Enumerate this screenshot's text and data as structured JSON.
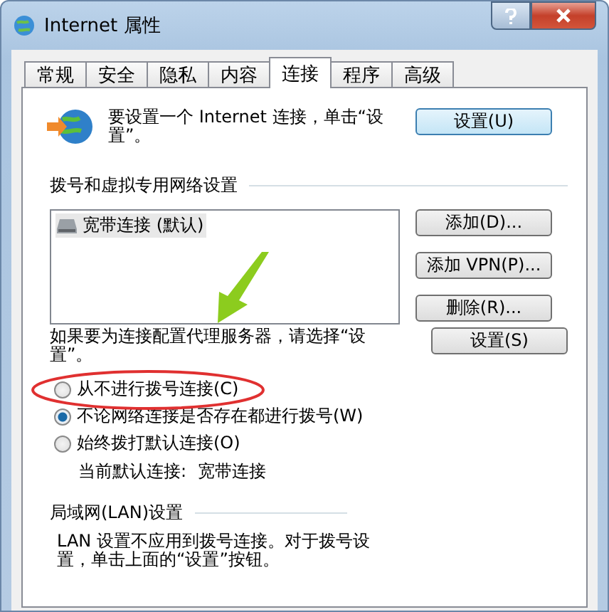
{
  "window": {
    "title": "Internet 属性"
  },
  "tabs": [
    {
      "label": "常规",
      "selected": false
    },
    {
      "label": "安全",
      "selected": false
    },
    {
      "label": "隐私",
      "selected": false
    },
    {
      "label": "内容",
      "selected": false
    },
    {
      "label": "连接",
      "selected": true
    },
    {
      "label": "程序",
      "selected": false
    },
    {
      "label": "高级",
      "selected": false
    }
  ],
  "setup": {
    "text": "要设置一个 Internet 连接，单击“设置”。",
    "button": "设置(U)"
  },
  "dialup": {
    "heading": "拨号和虚拟专用网络设置",
    "connections": [
      {
        "label": "宽带连接 (默认)",
        "selected": true
      }
    ],
    "buttons": [
      "添加(D)...",
      "添加 VPN(P)...",
      "删除(R)..."
    ],
    "proxy_text": "如果要为连接配置代理服务器，请选择“设置”。",
    "proxy_button": "设置(S)",
    "options": [
      {
        "label": "从不进行拨号连接(C)",
        "selected": false
      },
      {
        "label": "不论网络连接是否存在都进行拨号(W)",
        "selected": true
      },
      {
        "label": "始终拨打默认连接(O)",
        "selected": false
      }
    ],
    "current_label": "当前默认连接:",
    "current_value": "宽带连接"
  },
  "lan": {
    "heading": "局域网(LAN)设置",
    "text": "LAN 设置不应用到拨号连接。对于拨号设置，单击上面的“设置”按钮。"
  }
}
